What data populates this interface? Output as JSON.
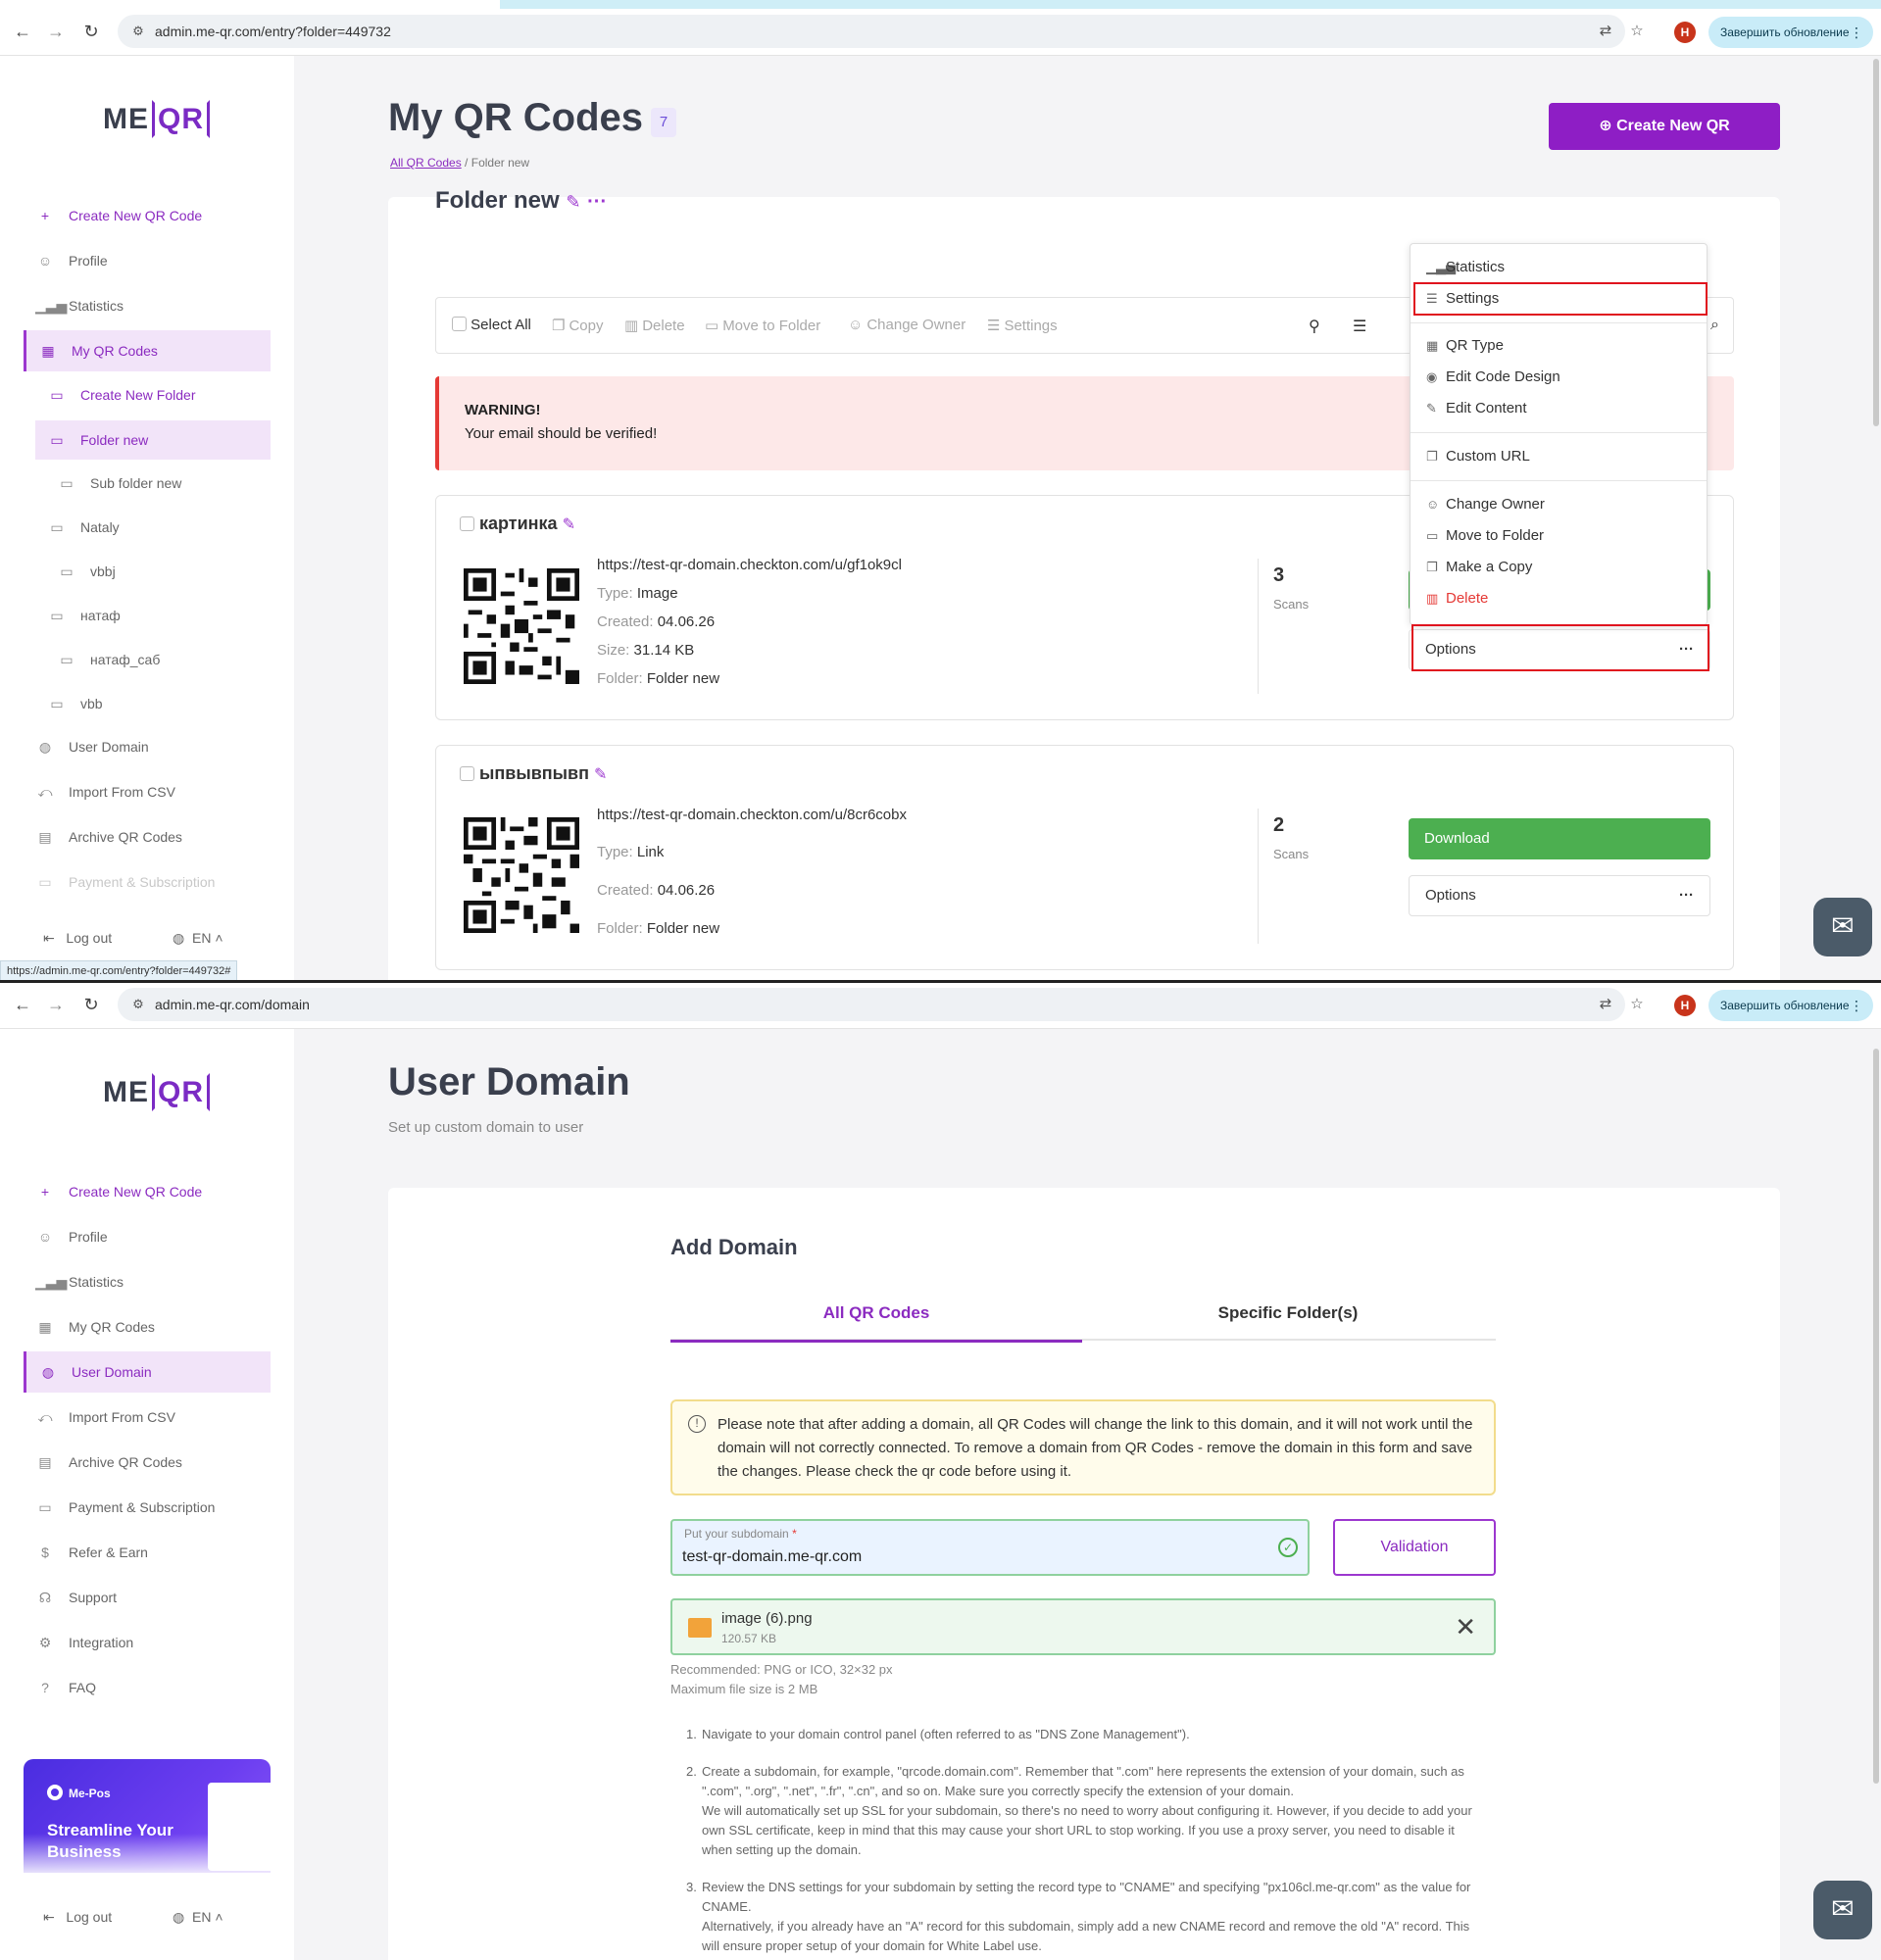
{
  "pane1": {
    "url": "admin.me-qr.com/entry?folder=449732",
    "status_url": "https://admin.me-qr.com/entry?folder=449732#",
    "update_label": "Завершить обновление",
    "profile_letter": "H",
    "logo": {
      "me": "ME",
      "qr": "QR"
    },
    "sidebar": {
      "create": "Create New QR Code",
      "profile": "Profile",
      "statistics": "Statistics",
      "my_qr": "My QR Codes",
      "create_folder": "Create New Folder",
      "folder_new": "Folder new",
      "sub_folder": "Sub folder new",
      "nataly": "Nataly",
      "vbbj": "vbbj",
      "natadf": "натаф",
      "natadf_sab": "натаф_саб",
      "vbb": "vbb",
      "user_domain": "User Domain",
      "import_csv": "Import From CSV",
      "archive": "Archive QR Codes",
      "payment": "Payment & Subscription",
      "logout": "Log out",
      "lang": "EN"
    },
    "title": "My QR Codes",
    "count": "7",
    "breadcrumb": {
      "root": "All QR Codes",
      "current": "Folder new",
      "sep": "/"
    },
    "create_btn": "Create New QR",
    "folder_title": "Folder new",
    "toolbar": {
      "select_all": "Select All",
      "copy": "Copy",
      "delete": "Delete",
      "move": "Move to Folder",
      "owner": "Change Owner",
      "settings": "Settings"
    },
    "warning": {
      "title": "WARNING!",
      "text": "Your email should be verified!"
    },
    "cards": [
      {
        "name": "картинка",
        "url": "https://test-qr-domain.checkton.com/u/gf1ok9cl",
        "type_k": "Type:",
        "type_v": "Image",
        "created_k": "Created:",
        "created_v": "04.06.26",
        "size_k": "Size:",
        "size_v": "31.14 KB",
        "folder_k": "Folder:",
        "folder_v": "Folder new",
        "scans": "3",
        "scans_label": "Scans",
        "options": "Options"
      },
      {
        "name": "ыпвывпывп",
        "url": "https://test-qr-domain.checkton.com/u/8cr6cobx",
        "type_k": "Type:",
        "type_v": "Link",
        "created_k": "Created:",
        "created_v": "04.06.26",
        "folder_k": "Folder:",
        "folder_v": "Folder new",
        "scans": "2",
        "scans_label": "Scans",
        "download": "Download",
        "options": "Options"
      }
    ],
    "menu": {
      "statistics": "Statistics",
      "settings": "Settings",
      "qr_type": "QR Type",
      "edit_design": "Edit Code Design",
      "edit_content": "Edit Content",
      "custom_url": "Custom URL",
      "change_owner": "Change Owner",
      "move": "Move to Folder",
      "copy": "Make a Copy",
      "delete": "Delete"
    },
    "highlight_color": "#e0141e"
  },
  "pane2": {
    "url": "admin.me-qr.com/domain",
    "update_label": "Завершить обновление",
    "profile_letter": "H",
    "logo": {
      "me": "ME",
      "qr": "QR"
    },
    "sidebar": {
      "create": "Create New QR Code",
      "profile": "Profile",
      "statistics": "Statistics",
      "my_qr": "My QR Codes",
      "user_domain": "User Domain",
      "import_csv": "Import From CSV",
      "archive": "Archive QR Codes",
      "payment": "Payment & Subscription",
      "refer": "Refer & Earn",
      "support": "Support",
      "integration": "Integration",
      "faq": "FAQ",
      "logout": "Log out",
      "lang": "EN"
    },
    "promo": {
      "brand": "Me-Pos",
      "headline": "Streamline Your Business"
    },
    "title": "User Domain",
    "subtitle": "Set up custom domain to user",
    "add_domain": "Add Domain",
    "tabs": {
      "all": "All QR Codes",
      "specific": "Specific Folder(s)"
    },
    "note": "Please note that after adding a domain, all QR Codes will change the link to this domain, and it will not work until the domain will not correctly connected. To remove a domain from QR Codes - remove the domain in this form and save the changes. Please check the qr code before using it.",
    "subdomain": {
      "label": "Put your subdomain",
      "req": "*",
      "value": "test-qr-domain.me-qr.com"
    },
    "validation": "Validation",
    "file": {
      "name": "image (6).png",
      "size": "120.57 KB"
    },
    "hint1": "Recommended: PNG or ICO, 32×32 px",
    "hint2": "Maximum file size is 2 MB",
    "steps": [
      {
        "n": "1.",
        "t": "Navigate to your domain control panel (often referred to as \"DNS Zone Management\")."
      },
      {
        "n": "2.",
        "t": "Create a subdomain, for example, \"qrcode.domain.com\". Remember that \".com\" here represents the extension of your domain, such as \".com\", \".org\", \".net\", \".fr\", \".cn\", and so on. Make sure you correctly specify the extension of your domain.",
        "t2": "We will automatically set up SSL for your subdomain, so there's no need to worry about configuring it. However, if you decide to add your own SSL certificate, keep in mind that this may cause your short URL to stop working. If you use a proxy server, you need to disable it when setting up the domain."
      },
      {
        "n": "3.",
        "t": "Review the DNS settings for your subdomain by setting the record type to \"CNAME\" and specifying \"px106cl.me-qr.com\" as the value for CNAME.",
        "t2": "Alternatively, if you already have an \"A\" record for this subdomain, simply add a new CNAME record and remove the old \"A\" record. This will ensure proper setup of your domain for White Label use."
      }
    ]
  }
}
